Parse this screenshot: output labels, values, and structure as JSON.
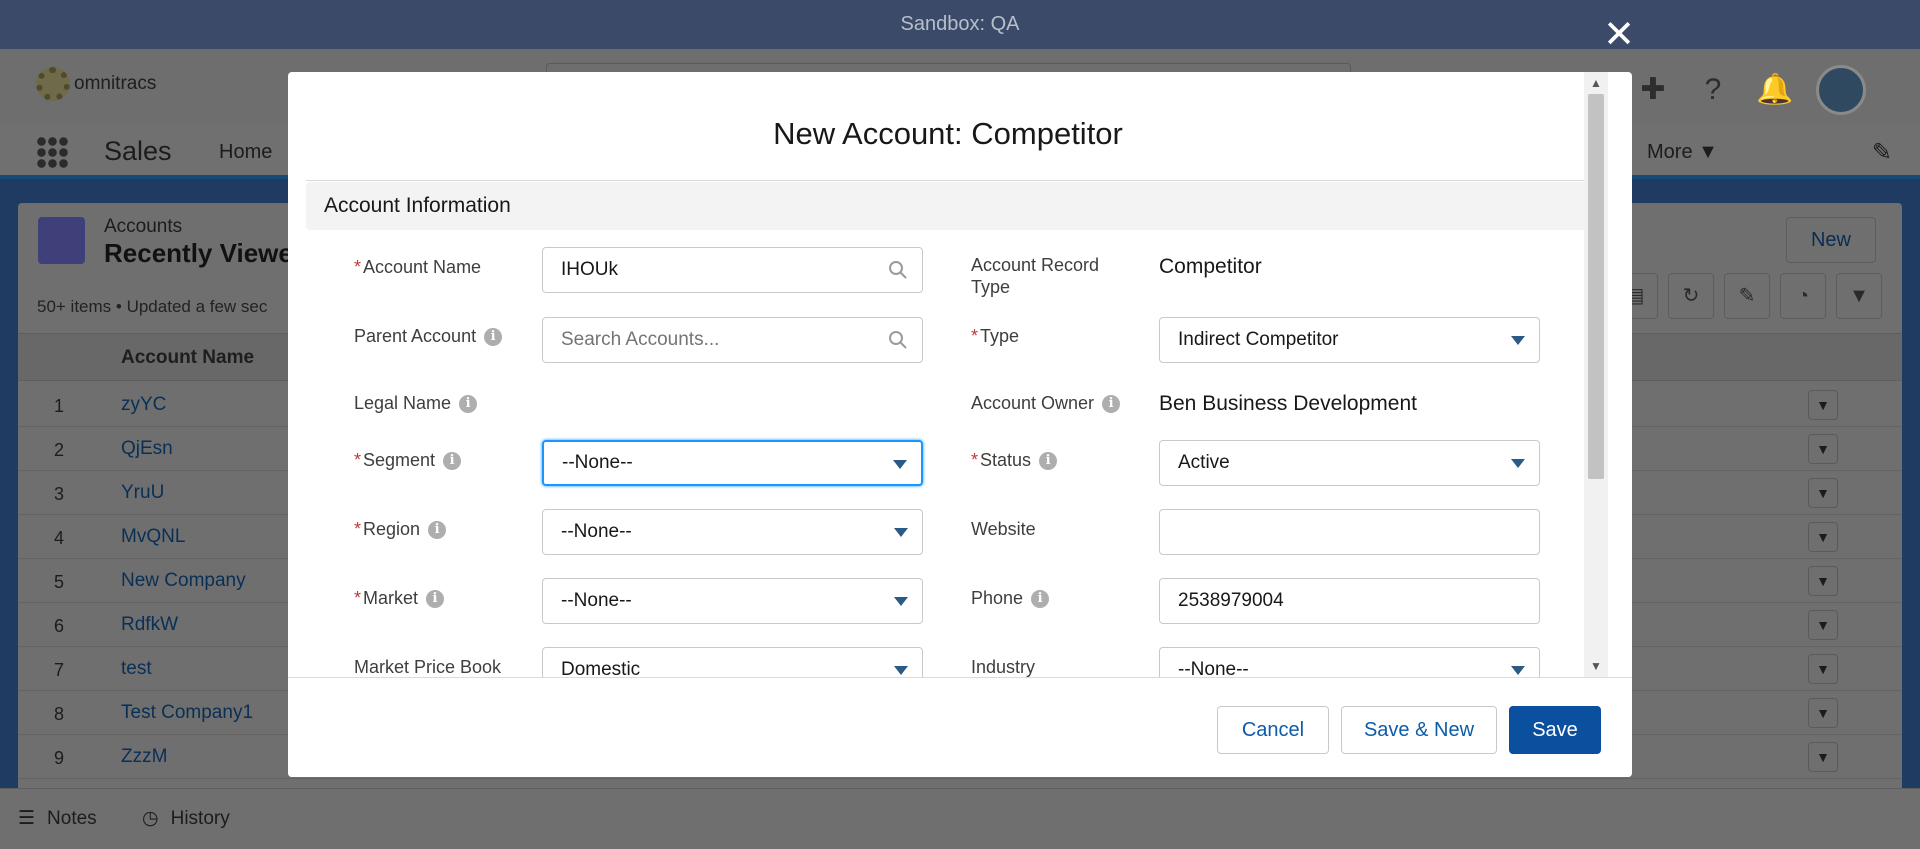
{
  "sandbox": {
    "label": "Sandbox: QA"
  },
  "header": {
    "logo_text": "omnitracs"
  },
  "nav": {
    "app_name": "Sales",
    "home": "Home",
    "more": "More"
  },
  "list": {
    "object_label": "Accounts",
    "title": "Recently Viewe",
    "meta": "50+ items • Updated a few sec",
    "new_label": "New",
    "column_account_name": "Account Name",
    "rows": [
      {
        "num": "1",
        "name": "zyYC"
      },
      {
        "num": "2",
        "name": "QjEsn"
      },
      {
        "num": "3",
        "name": "YruU"
      },
      {
        "num": "4",
        "name": "MvQNL"
      },
      {
        "num": "5",
        "name": "New Company"
      },
      {
        "num": "6",
        "name": "RdfkW"
      },
      {
        "num": "7",
        "name": "test"
      },
      {
        "num": "8",
        "name": "Test Company1"
      },
      {
        "num": "9",
        "name": "ZzzM"
      }
    ]
  },
  "utility": {
    "notes": "Notes",
    "history": "History"
  },
  "modal": {
    "title": "New Account: Competitor",
    "section": "Account Information",
    "fields": {
      "account_name": {
        "label": "Account Name",
        "value": "IHOUk"
      },
      "parent_account": {
        "label": "Parent Account",
        "placeholder": "Search Accounts..."
      },
      "legal_name": {
        "label": "Legal Name"
      },
      "segment": {
        "label": "Segment",
        "value": "--None--"
      },
      "region": {
        "label": "Region",
        "value": "--None--"
      },
      "market": {
        "label": "Market",
        "value": "--None--"
      },
      "market_price_book": {
        "label": "Market Price Book",
        "value": "Domestic"
      },
      "record_type": {
        "label": "Account Record Type",
        "value": "Competitor"
      },
      "type": {
        "label": "Type",
        "value": "Indirect Competitor"
      },
      "owner": {
        "label": "Account Owner",
        "value": "Ben Business Development"
      },
      "status": {
        "label": "Status",
        "value": "Active"
      },
      "website": {
        "label": "Website",
        "value": ""
      },
      "phone": {
        "label": "Phone",
        "value": "2538979004"
      },
      "industry": {
        "label": "Industry",
        "value": "--None--"
      }
    },
    "buttons": {
      "cancel": "Cancel",
      "save_new": "Save & New",
      "save": "Save"
    }
  },
  "colors": {
    "brand": "#0b4f9f",
    "focus": "#1b96ff",
    "required": "#c23934"
  }
}
